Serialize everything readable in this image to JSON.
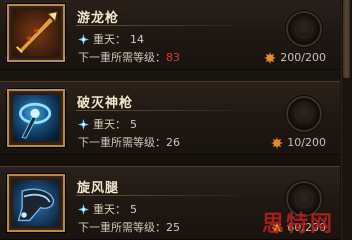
{
  "items": [
    {
      "name": "游龙枪",
      "icon": "dragon-spear-icon",
      "level_label": "重天：",
      "level_value": "14",
      "req_label": "下一重所需等级：",
      "req_value": "83",
      "req_value_color": "#e03a2e",
      "cost": "200/200"
    },
    {
      "name": "破灭神枪",
      "icon": "blue-spear-icon",
      "level_label": "重天：",
      "level_value": "5",
      "req_label": "下一重所需等级：",
      "req_value": "26",
      "req_value_color": "#cfc6b4",
      "cost": "10/200"
    },
    {
      "name": "旋风腿",
      "icon": "whirlwind-boot-icon",
      "level_label": "重天：",
      "level_value": "5",
      "req_label": "下一重所需等级：",
      "req_value": "25",
      "req_value_color": "#cfc6b4",
      "cost": "60/200"
    }
  ],
  "icons": {
    "star": "blue-star-icon",
    "currency": "maple-leaf-icon"
  },
  "watermark": "思特网"
}
